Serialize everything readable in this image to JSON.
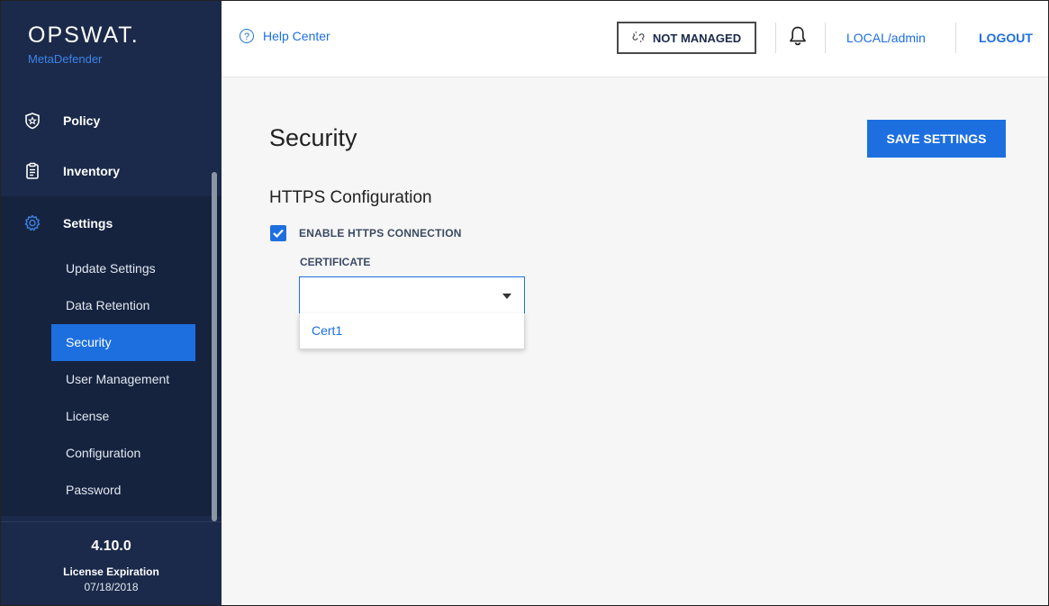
{
  "brand": {
    "logo": "OPSWAT.",
    "product": "MetaDefender"
  },
  "nav": {
    "items": [
      {
        "label": "Policy",
        "icon": "shield-star-icon"
      },
      {
        "label": "Inventory",
        "icon": "clipboard-icon"
      },
      {
        "label": "Settings",
        "icon": "gear-icon"
      }
    ],
    "settings_sub": [
      "Update Settings",
      "Data Retention",
      "Security",
      "User Management",
      "License",
      "Configuration",
      "Password"
    ],
    "selected_sub": "Security"
  },
  "footer": {
    "version": "4.10.0",
    "license_label": "License Expiration",
    "license_date": "07/18/2018"
  },
  "header": {
    "help": "Help Center",
    "not_managed": "NOT MANAGED",
    "user": "LOCAL/admin",
    "logout": "LOGOUT"
  },
  "main": {
    "title": "Security",
    "save_label": "SAVE SETTINGS",
    "section_title": "HTTPS Configuration",
    "enable_https_label": "ENABLE HTTPS CONNECTION",
    "enable_https_checked": true,
    "certificate_label": "CERTIFICATE",
    "certificate_value": "",
    "certificate_options": [
      "Cert1"
    ]
  },
  "colors": {
    "sidebar_bg": "#1b2a4a",
    "accent": "#1d6fe0",
    "content_bg": "#f6f6f6"
  }
}
